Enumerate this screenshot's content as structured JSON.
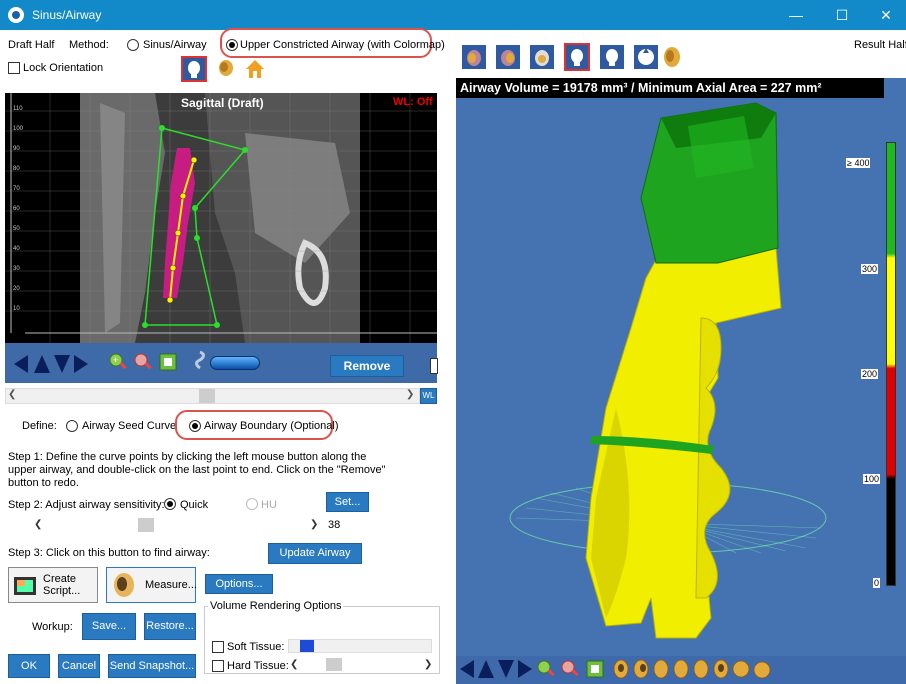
{
  "window": {
    "title": "Sinus/Airway",
    "minimize": "—",
    "maximize": "☐",
    "close": "✕"
  },
  "left": {
    "draft_half": "Draft Half",
    "method_label": "Method:",
    "method_options": [
      "Sinus/Airway",
      "Upper Constricted Airway (with Colormap)"
    ],
    "lock_orientation": "Lock Orientation",
    "sagittal_title": "Sagittal (Draft)",
    "wl_status": "WL: Off",
    "ruler_ticks": [
      "110",
      "100",
      "90",
      "80",
      "70",
      "60",
      "50",
      "40",
      "30",
      "20",
      "10"
    ],
    "remove_button": "Remove",
    "wl_button": "WL",
    "define_label": "Define:",
    "define_options": [
      "Airway Seed Curve",
      "Airway Boundary (Optional)"
    ],
    "step1": "Step 1: Define the curve points by clicking the left mouse button along the upper airway, and double-click on the last point to end.  Click on the \"Remove\" button to redo.",
    "step2": "Step 2: Adjust airway sensitivity:",
    "sensitivity_options": [
      "Quick",
      "HU"
    ],
    "set_button": "Set...",
    "sensitivity_value": "38",
    "step3": "Step 3: Click on this button to find airway:",
    "update_airway": "Update Airway",
    "create_script": "Create Script...",
    "measure": "Measure...",
    "options": "Options...",
    "volume_rendering_options": "Volume Rendering Options",
    "workup_label": "Workup:",
    "save": "Save...",
    "restore": "Restore...",
    "soft_tissue": "Soft Tissue:",
    "hard_tissue": "Hard Tissue:",
    "ok": "OK",
    "cancel": "Cancel",
    "send_snapshot": "Send Snapshot..."
  },
  "right": {
    "result_half": "Result Half",
    "airway_info": "Airway Volume = 19178 mm³ / Minimum Axial Area = 227 mm²",
    "colorbar_labels": [
      "≥ 400",
      "300",
      "200",
      "100",
      "0"
    ]
  },
  "colors": {
    "titlebar": "#1289c9",
    "accent_blue": "#2a7ac2",
    "render_bg": "#4573b2",
    "airway_yellow": "#f2ee00",
    "airway_green": "#1fa41f",
    "highlight_red": "#d9534f"
  }
}
